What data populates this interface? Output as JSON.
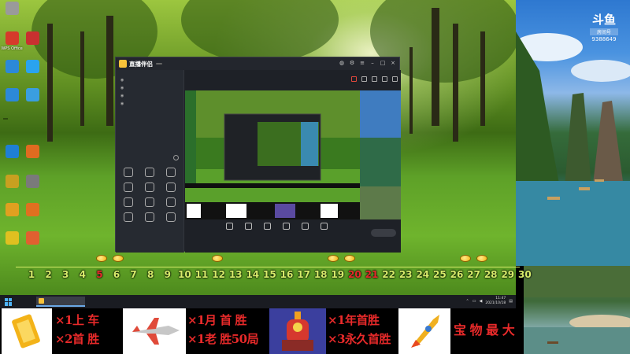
{
  "desktop": {
    "icons": [
      {
        "label": "",
        "icon": "image-file-icon",
        "color": "#9a9a9a"
      },
      {
        "label": "WPS Office",
        "icon": "wps-icon",
        "color": "#d63b2b"
      },
      {
        "label": "",
        "icon": "app-icon",
        "color": "#c83030"
      },
      {
        "label": "",
        "icon": "computer-icon",
        "color": "#2c89d8"
      },
      {
        "label": "",
        "icon": "app-icon",
        "color": "#2aa3ef"
      },
      {
        "label": "",
        "icon": "network-icon",
        "color": "#2c89d8"
      },
      {
        "label": "",
        "icon": "app-icon",
        "color": "#3a9ee0"
      },
      {
        "label": "",
        "icon": "edge-icon",
        "color": "#1f7fd4"
      },
      {
        "label": "",
        "icon": "app-icon",
        "color": "#e06b20"
      },
      {
        "label": "",
        "icon": "app-icon",
        "color": "#c8a020"
      },
      {
        "label": "",
        "icon": "app-icon",
        "color": "#7a7a7a"
      },
      {
        "label": "",
        "icon": "app-icon",
        "color": "#e0a020"
      },
      {
        "label": "",
        "icon": "app-icon",
        "color": "#e07020"
      },
      {
        "label": "",
        "icon": "app-icon",
        "color": "#e0c020"
      },
      {
        "label": "",
        "icon": "app-icon",
        "color": "#e06030"
      }
    ],
    "notice": ""
  },
  "app": {
    "title": "直播伴侣",
    "version": "",
    "room_bar": {
      "text": "",
      "badge": ""
    },
    "left_tabs": [
      {
        "label": "",
        "active": true
      },
      {
        "label": ""
      },
      {
        "label": ""
      }
    ],
    "scenes": [
      {
        "label": ""
      },
      {
        "label": ""
      },
      {
        "label": ""
      },
      {
        "label": ""
      }
    ],
    "tools_title": "",
    "tools": [
      {
        "label": "",
        "hot": true
      },
      {
        "label": ""
      },
      {
        "label": ""
      },
      {
        "label": ""
      },
      {
        "label": ""
      },
      {
        "label": "",
        "hot": true
      },
      {
        "label": ""
      },
      {
        "label": ""
      },
      {
        "label": ""
      },
      {
        "label": ""
      },
      {
        "label": ""
      },
      {
        "label": ""
      }
    ],
    "bottom_buttons": [
      {
        "label": ""
      },
      {
        "label": ""
      },
      {
        "label": ""
      },
      {
        "label": ""
      },
      {
        "label": ""
      },
      {
        "label": ""
      }
    ],
    "golive_label": "",
    "status": [
      "",
      "",
      "",
      ""
    ]
  },
  "brand": {
    "logo": "斗鱼",
    "sub": "房间号",
    "number": "9388649"
  },
  "calendar": {
    "days": [
      {
        "d": "1",
        "red": false
      },
      {
        "d": "2"
      },
      {
        "d": "3"
      },
      {
        "d": "4"
      },
      {
        "d": "5",
        "red": true
      },
      {
        "d": "6"
      },
      {
        "d": "7"
      },
      {
        "d": "8"
      },
      {
        "d": "9"
      },
      {
        "d": "10"
      },
      {
        "d": "11"
      },
      {
        "d": "12"
      },
      {
        "d": "13"
      },
      {
        "d": "14"
      },
      {
        "d": "15"
      },
      {
        "d": "16"
      },
      {
        "d": "17"
      },
      {
        "d": "18"
      },
      {
        "d": "19"
      },
      {
        "d": "20",
        "red": true
      },
      {
        "d": "21",
        "red": true
      },
      {
        "d": "22"
      },
      {
        "d": "23"
      },
      {
        "d": "24"
      },
      {
        "d": "25"
      },
      {
        "d": "26"
      },
      {
        "d": "27"
      },
      {
        "d": "28"
      },
      {
        "d": "29"
      },
      {
        "d": "30"
      }
    ]
  },
  "taskbar": {
    "app_label": "",
    "time": "11:47",
    "date": "2021/10/18"
  },
  "rewards": [
    {
      "text1": "×1上 车",
      "text2": "×2首 胜",
      "pic": "gold-bar-icon"
    },
    {
      "text1": "×1月 首 胜",
      "text2": "×1老 胜50局",
      "pic": "jet-plane-icon"
    },
    {
      "text1": "×1年首胜",
      "text2": "×3永久首胜",
      "pic": "robot-icon"
    },
    {
      "text1": "宝 物 最 大",
      "text2": "",
      "pic": "rocket-icon"
    }
  ]
}
